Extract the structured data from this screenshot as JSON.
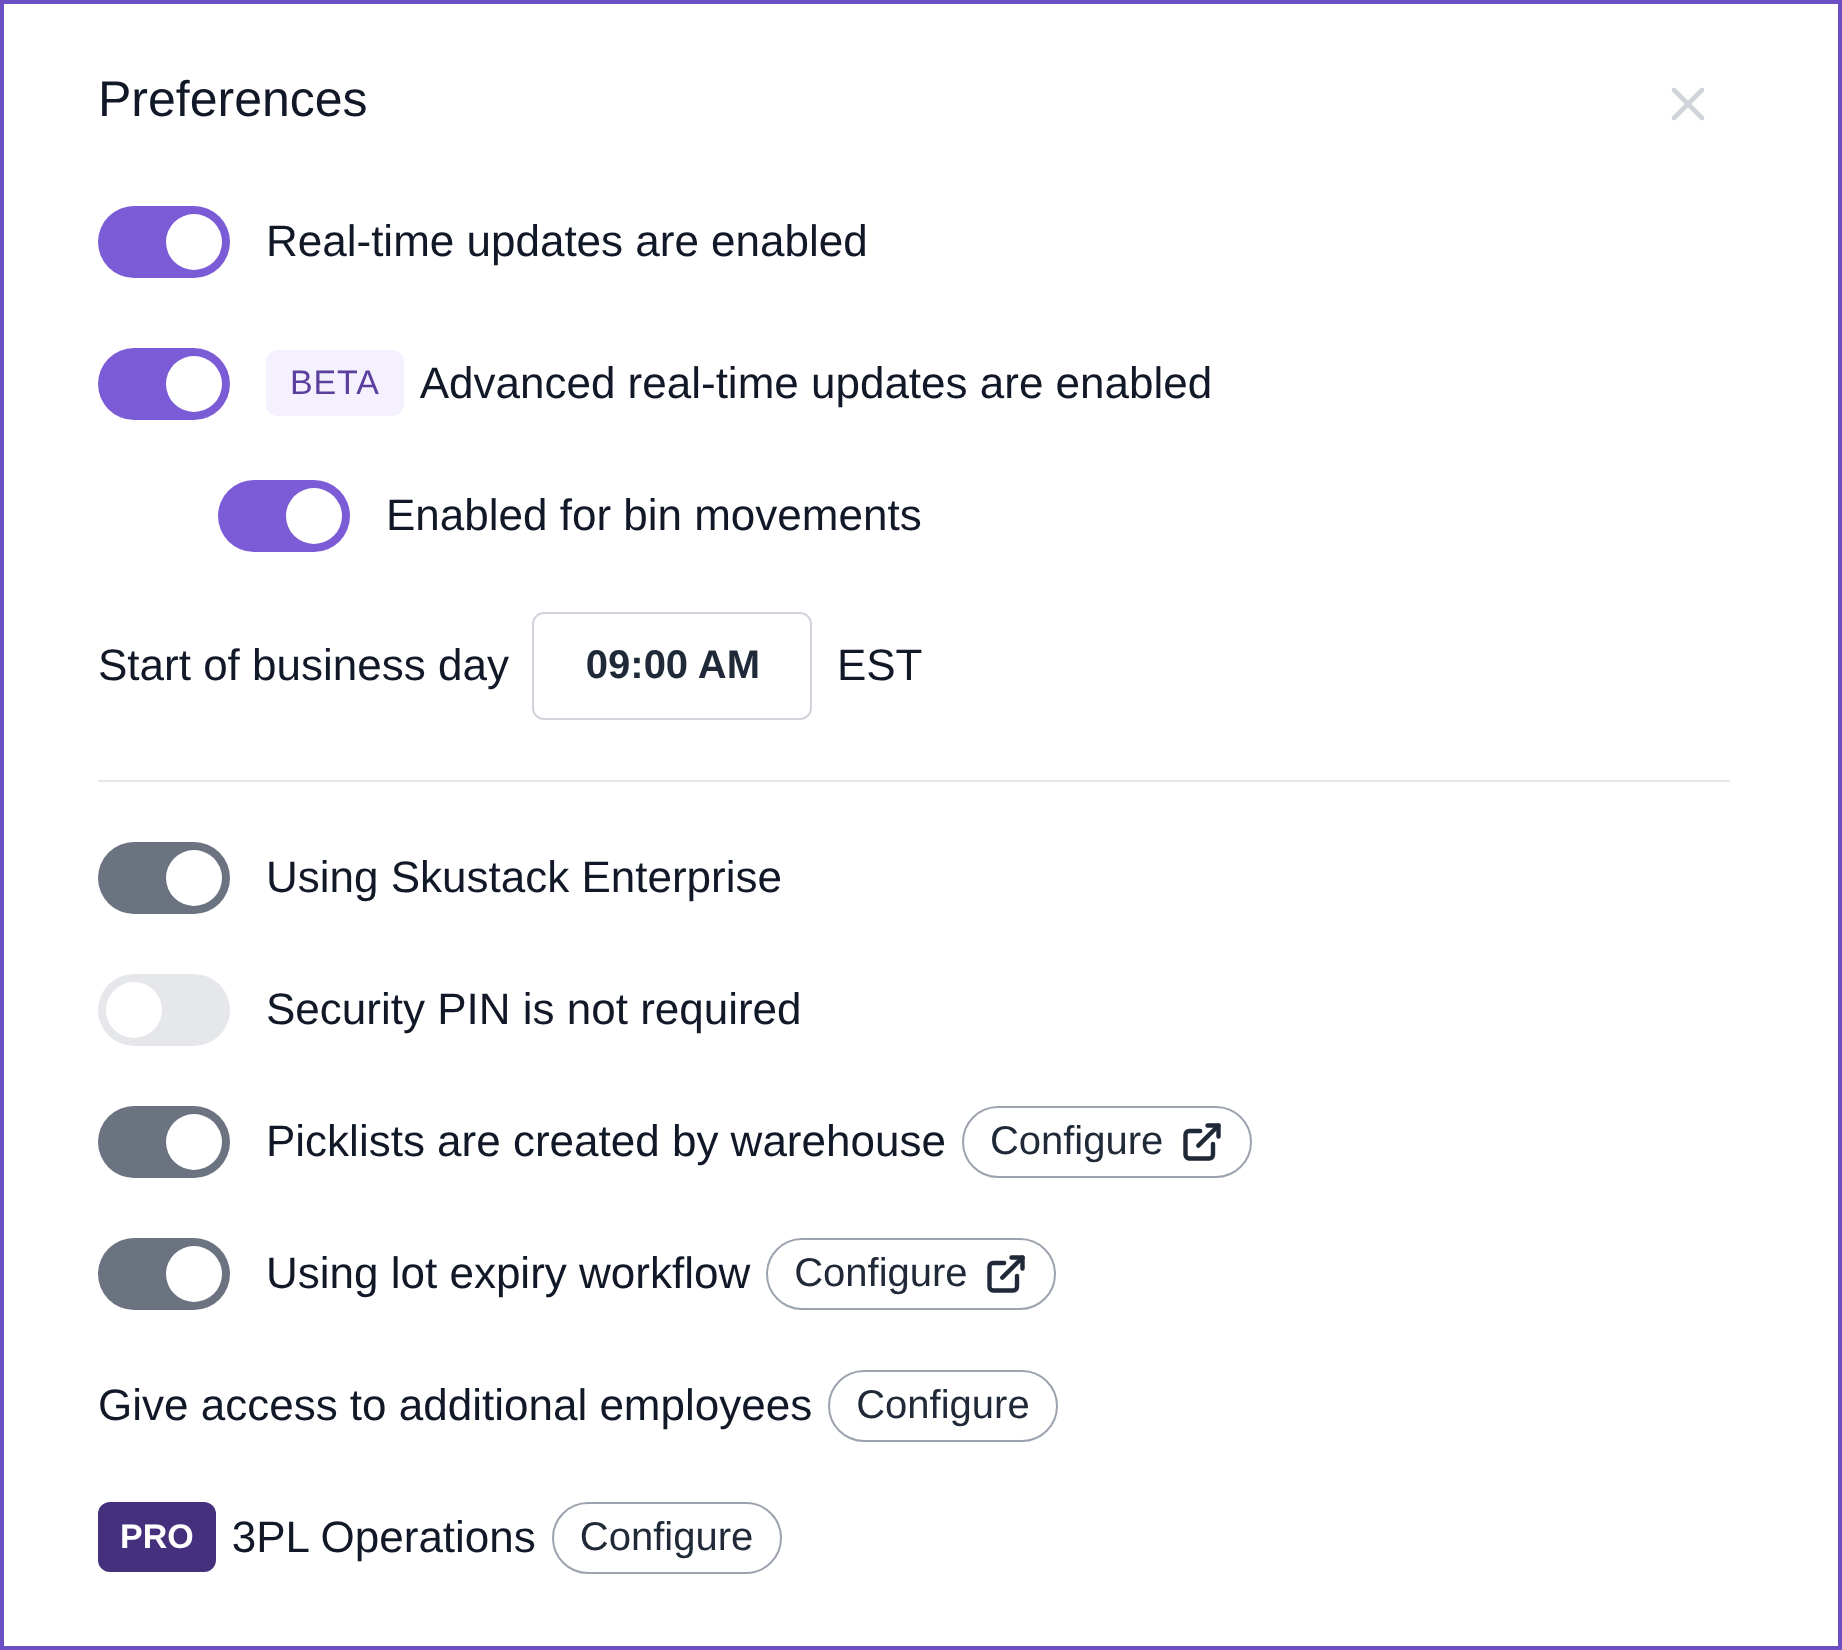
{
  "title": "Preferences",
  "realtime": [
    {
      "kind": "toggle",
      "label": "Real-time updates are enabled",
      "on": true,
      "disabled": false
    },
    {
      "kind": "toggle",
      "label": "Advanced real-time updates are enabled",
      "on": true,
      "disabled": false,
      "badge": {
        "kind": "beta",
        "text": "BETA"
      },
      "children": [
        {
          "kind": "toggle",
          "label": "Enabled for bin movements",
          "on": true,
          "disabled": false
        }
      ]
    }
  ],
  "business_day": {
    "label": "Start of business day",
    "value": "09:00 AM",
    "timezone": "EST"
  },
  "settings": [
    {
      "kind": "toggle",
      "label": "Using Skustack Enterprise",
      "on": true,
      "disabled": true
    },
    {
      "kind": "toggle",
      "label": "Security PIN is not required",
      "on": false,
      "disabled": true
    },
    {
      "kind": "toggle",
      "label": "Picklists are created by warehouse",
      "on": true,
      "disabled": true,
      "configure": {
        "label": "Configure",
        "external": true
      }
    },
    {
      "kind": "toggle",
      "label": "Using lot expiry workflow",
      "on": true,
      "disabled": true,
      "configure": {
        "label": "Configure",
        "external": true
      }
    },
    {
      "kind": "text",
      "label": "Give access to additional employees",
      "configure": {
        "label": "Configure",
        "external": false
      }
    },
    {
      "kind": "text",
      "label": "3PL Operations",
      "badge": {
        "kind": "pro",
        "text": "PRO"
      },
      "configure": {
        "label": "Configure",
        "external": false
      }
    }
  ]
}
